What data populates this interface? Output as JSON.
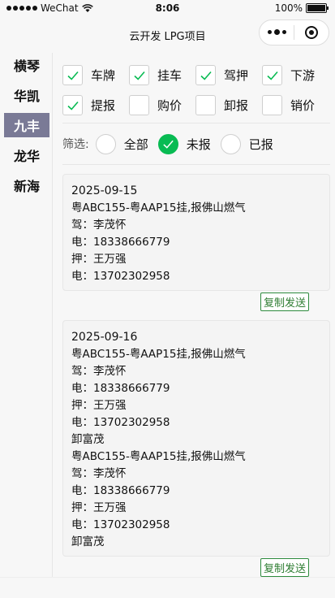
{
  "status_bar": {
    "carrier": "WeChat",
    "time": "8:06",
    "battery_text": "100%",
    "battery_level": 1.0
  },
  "nav": {
    "title": "云开发 LPG项目"
  },
  "sidebar": {
    "items": [
      {
        "label": "横琴",
        "active": false
      },
      {
        "label": "华凯",
        "active": false
      },
      {
        "label": "九丰",
        "active": true
      },
      {
        "label": "龙华",
        "active": false
      },
      {
        "label": "新海",
        "active": false
      }
    ]
  },
  "checkboxes": [
    {
      "label": "车牌",
      "checked": true
    },
    {
      "label": "挂车",
      "checked": true
    },
    {
      "label": "驾押",
      "checked": true
    },
    {
      "label": "下游",
      "checked": true
    },
    {
      "label": "提报",
      "checked": true
    },
    {
      "label": "购价",
      "checked": false
    },
    {
      "label": "卸报",
      "checked": false
    },
    {
      "label": "销价",
      "checked": false
    }
  ],
  "filter": {
    "label": "筛选:",
    "options": [
      {
        "label": "全部",
        "selected": false
      },
      {
        "label": "未报",
        "selected": true
      },
      {
        "label": "已报",
        "selected": false
      }
    ]
  },
  "cards": [
    {
      "lines": [
        "2025-09-15",
        "粤ABC155-粤AAP15挂,报佛山燃气",
        "驾：李茂怀",
        "电：18338666779",
        "押：王万强",
        "电：13702302958"
      ],
      "copy_label": "复制发送"
    },
    {
      "lines": [
        "2025-09-16",
        "粤ABC155-粤AAP15挂,报佛山燃气",
        "驾：李茂怀",
        "电：18338666779",
        "押：王万强",
        "电：13702302958",
        "卸富茂",
        "粤ABC155-粤AAP15挂,报佛山燃气",
        "驾：李茂怀",
        "电：18338666779",
        "押：王万强",
        "电：13702302958",
        "卸富茂"
      ],
      "copy_label": "复制发送"
    }
  ],
  "colors": {
    "accent_green": "#09bb53",
    "check_green": "#09bb53",
    "sidebar_active_bg": "#7a7a96",
    "copy_button_border": "#2e8b3e"
  },
  "icons": {
    "checkmark": "check-icon",
    "menu": "more-dots-icon",
    "close": "target-close-icon",
    "wifi": "wifi-icon",
    "signal": "signal-dots-icon",
    "battery": "battery-icon"
  }
}
